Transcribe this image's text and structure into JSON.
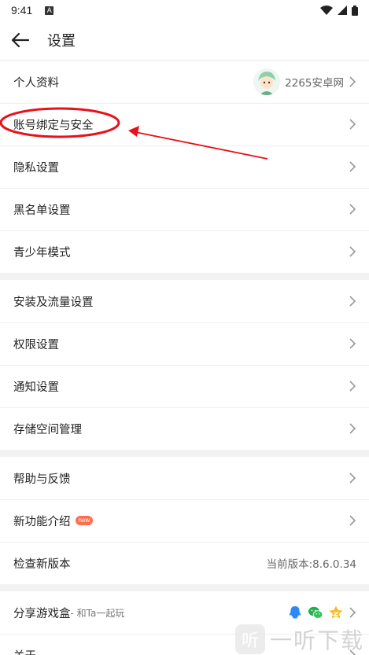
{
  "status_bar": {
    "time": "9:41",
    "a_label": "A"
  },
  "header": {
    "title": "设置"
  },
  "groups": [
    {
      "items": [
        {
          "label": "个人资料",
          "value": "2265安卓网",
          "has_avatar": true
        },
        {
          "label": "账号绑定与安全"
        },
        {
          "label": "隐私设置"
        },
        {
          "label": "黑名单设置"
        },
        {
          "label": "青少年模式"
        }
      ]
    },
    {
      "items": [
        {
          "label": "安装及流量设置"
        },
        {
          "label": "权限设置"
        },
        {
          "label": "通知设置"
        },
        {
          "label": "存储空间管理"
        }
      ]
    },
    {
      "items": [
        {
          "label": "帮助与反馈"
        },
        {
          "label": "新功能介绍",
          "badge": "new"
        },
        {
          "label": "检查新版本",
          "value": "当前版本:8.6.0.34"
        }
      ]
    },
    {
      "items": [
        {
          "label": "分享游戏盒",
          "sublabel": " - 和Ta一起玩"
        },
        {
          "label": "关于"
        }
      ]
    }
  ],
  "share_icons": [
    "qq-icon",
    "wechat-icon",
    "qzone-icon"
  ],
  "watermark": {
    "logo_char": "听",
    "text": "一听下载"
  },
  "colors": {
    "annotation_red": "#e8101a",
    "badge": "#ff6f4f",
    "section_gap": "#f2f2f2"
  }
}
